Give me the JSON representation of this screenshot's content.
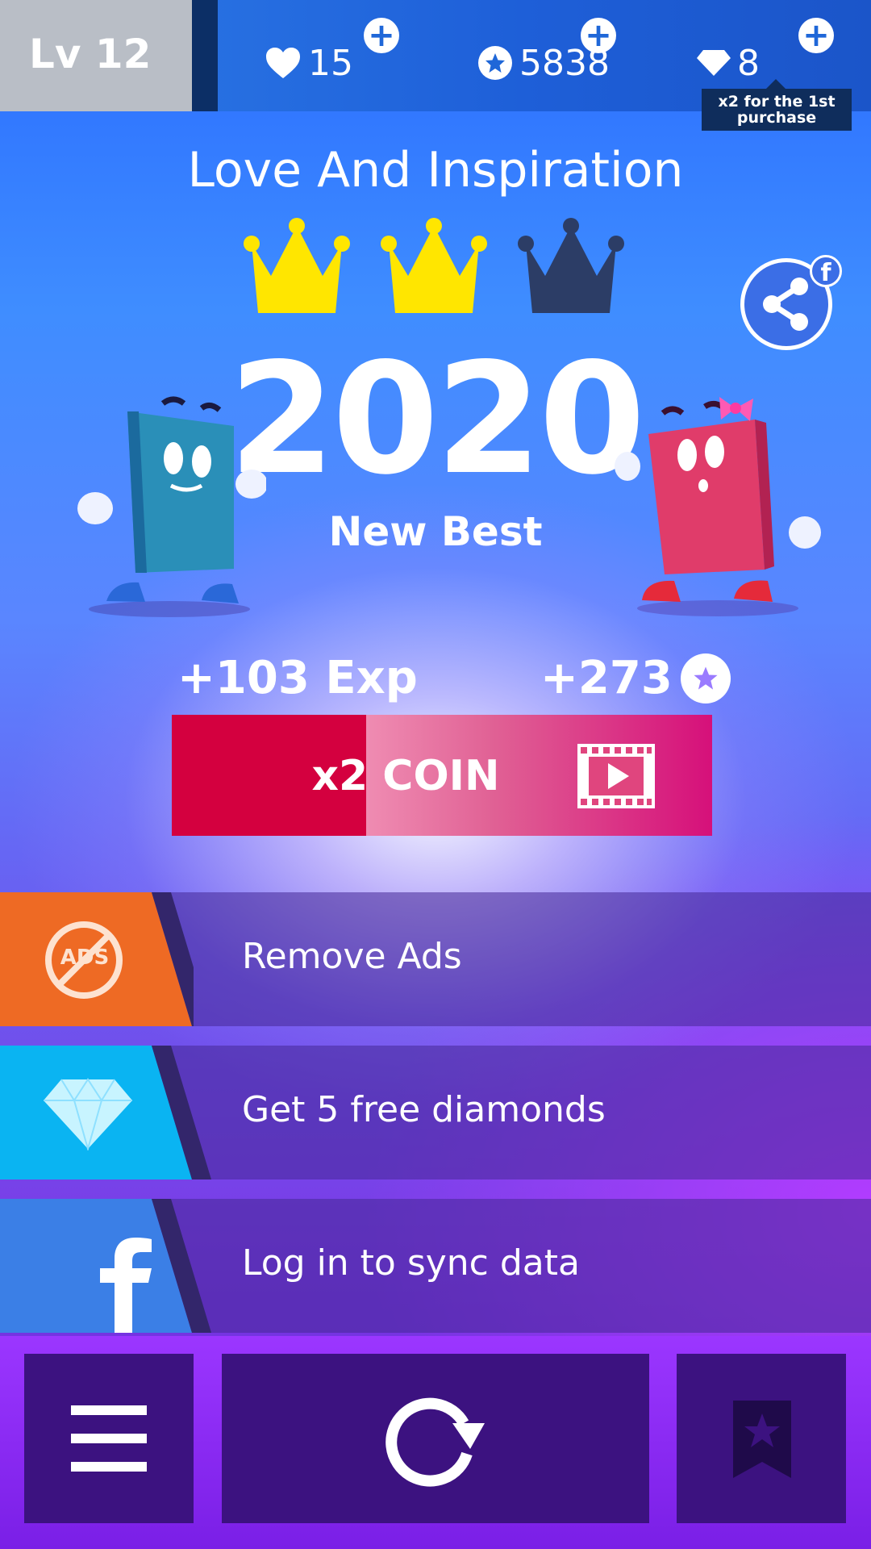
{
  "topbar": {
    "level": "Lv 12",
    "lives": "15",
    "coins": "5838",
    "diamonds": "8",
    "tooltip": "x2 for the 1st purchase"
  },
  "result": {
    "song_title": "Love And Inspiration",
    "crowns_earned": 2,
    "crowns_total": 3,
    "score": "2020",
    "best_label": "New Best",
    "exp_gain": "+103 Exp",
    "coin_gain": "+273"
  },
  "x2_button": {
    "label": "x2 COIN"
  },
  "offers": [
    {
      "label": "Remove Ads",
      "icon": "no-ads-icon",
      "badge": "ADS",
      "color": "#ee6a24"
    },
    {
      "label": "Get 5 free diamonds",
      "icon": "diamond-icon",
      "color": "#0ab4f2"
    },
    {
      "label": "Log in to sync data",
      "icon": "facebook-icon",
      "color": "#3b7fe6"
    }
  ],
  "share": {
    "badge": "f"
  },
  "colors": {
    "accent_red": "#d4003f",
    "crown_gold": "#ffe600",
    "crown_dark": "#2c3d66"
  }
}
